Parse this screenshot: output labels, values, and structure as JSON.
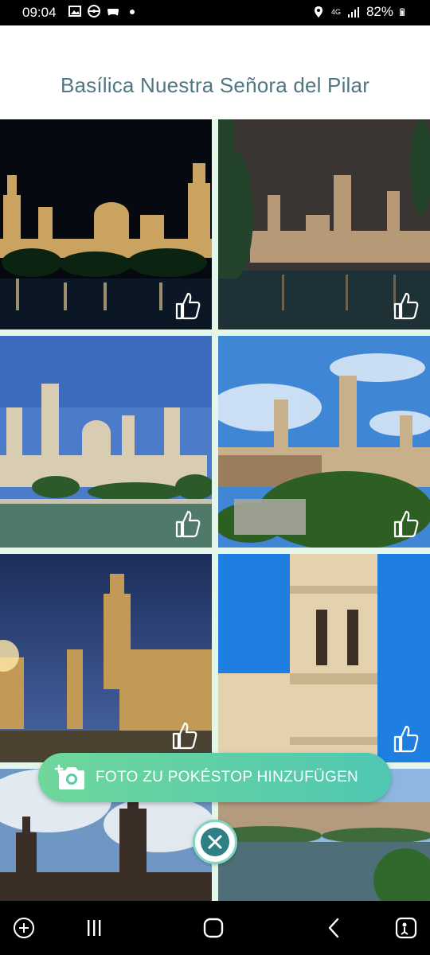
{
  "status_bar": {
    "time": "09:04",
    "left_icons": [
      "gallery-icon",
      "pokemon-go-icon",
      "game-controller-icon",
      "dot-icon"
    ],
    "right_icons": [
      "location-icon",
      "4g-signal-icon",
      "signal-bars-icon"
    ],
    "network": "4G",
    "battery": "82%"
  },
  "header": {
    "title": "Basílica Nuestra Señora del Pilar"
  },
  "photos": [
    {
      "id": "night-river-view",
      "icon": "thumbs-up-icon"
    },
    {
      "id": "night-cloudy-view",
      "icon": "thumbs-up-icon"
    },
    {
      "id": "day-river-view",
      "icon": "thumbs-up-icon"
    },
    {
      "id": "day-trees-view",
      "icon": "thumbs-up-icon"
    },
    {
      "id": "dusk-square-view",
      "icon": "thumbs-up-icon"
    },
    {
      "id": "tower-closeup",
      "icon": "thumbs-up-icon"
    },
    {
      "id": "cloudy-domes",
      "icon": "thumbs-up-icon"
    },
    {
      "id": "river-bank",
      "icon": "thumbs-up-icon"
    }
  ],
  "add_photo_button": {
    "label": "FOTO ZU POKÉSTOP HINZUFÜGEN",
    "icon": "add-camera-icon"
  },
  "close_button": {
    "icon": "close-icon"
  },
  "nav_bar": {
    "items": [
      "game-icon",
      "recent-apps-icon",
      "home-icon",
      "back-icon",
      "accessibility-icon"
    ]
  },
  "colors": {
    "title": "#4f7781",
    "grid_background": "#e4f6ea",
    "button_gradient_start": "#6fd79b",
    "button_gradient_end": "#4fc7b2",
    "close_inner": "#2f7f86"
  }
}
